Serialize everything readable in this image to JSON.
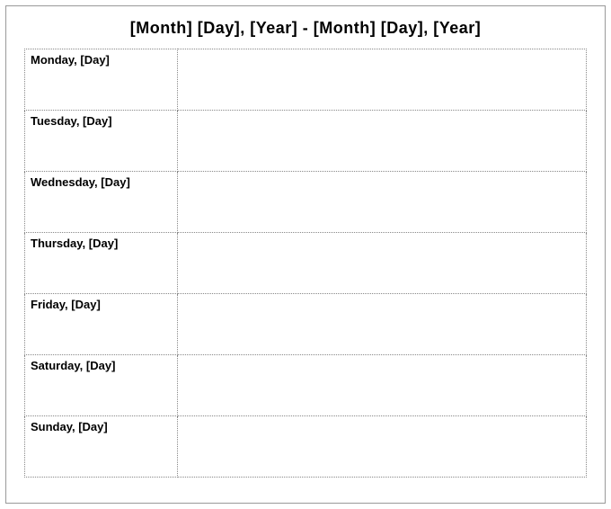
{
  "title": "[Month]  [Day], [Year] - [Month] [Day], [Year]",
  "days": [
    {
      "label": "Monday, [Day]",
      "content": ""
    },
    {
      "label": "Tuesday, [Day]",
      "content": ""
    },
    {
      "label": "Wednesday, [Day]",
      "content": ""
    },
    {
      "label": "Thursday, [Day]",
      "content": ""
    },
    {
      "label": "Friday, [Day]",
      "content": ""
    },
    {
      "label": "Saturday, [Day]",
      "content": ""
    },
    {
      "label": "Sunday, [Day]",
      "content": ""
    }
  ]
}
